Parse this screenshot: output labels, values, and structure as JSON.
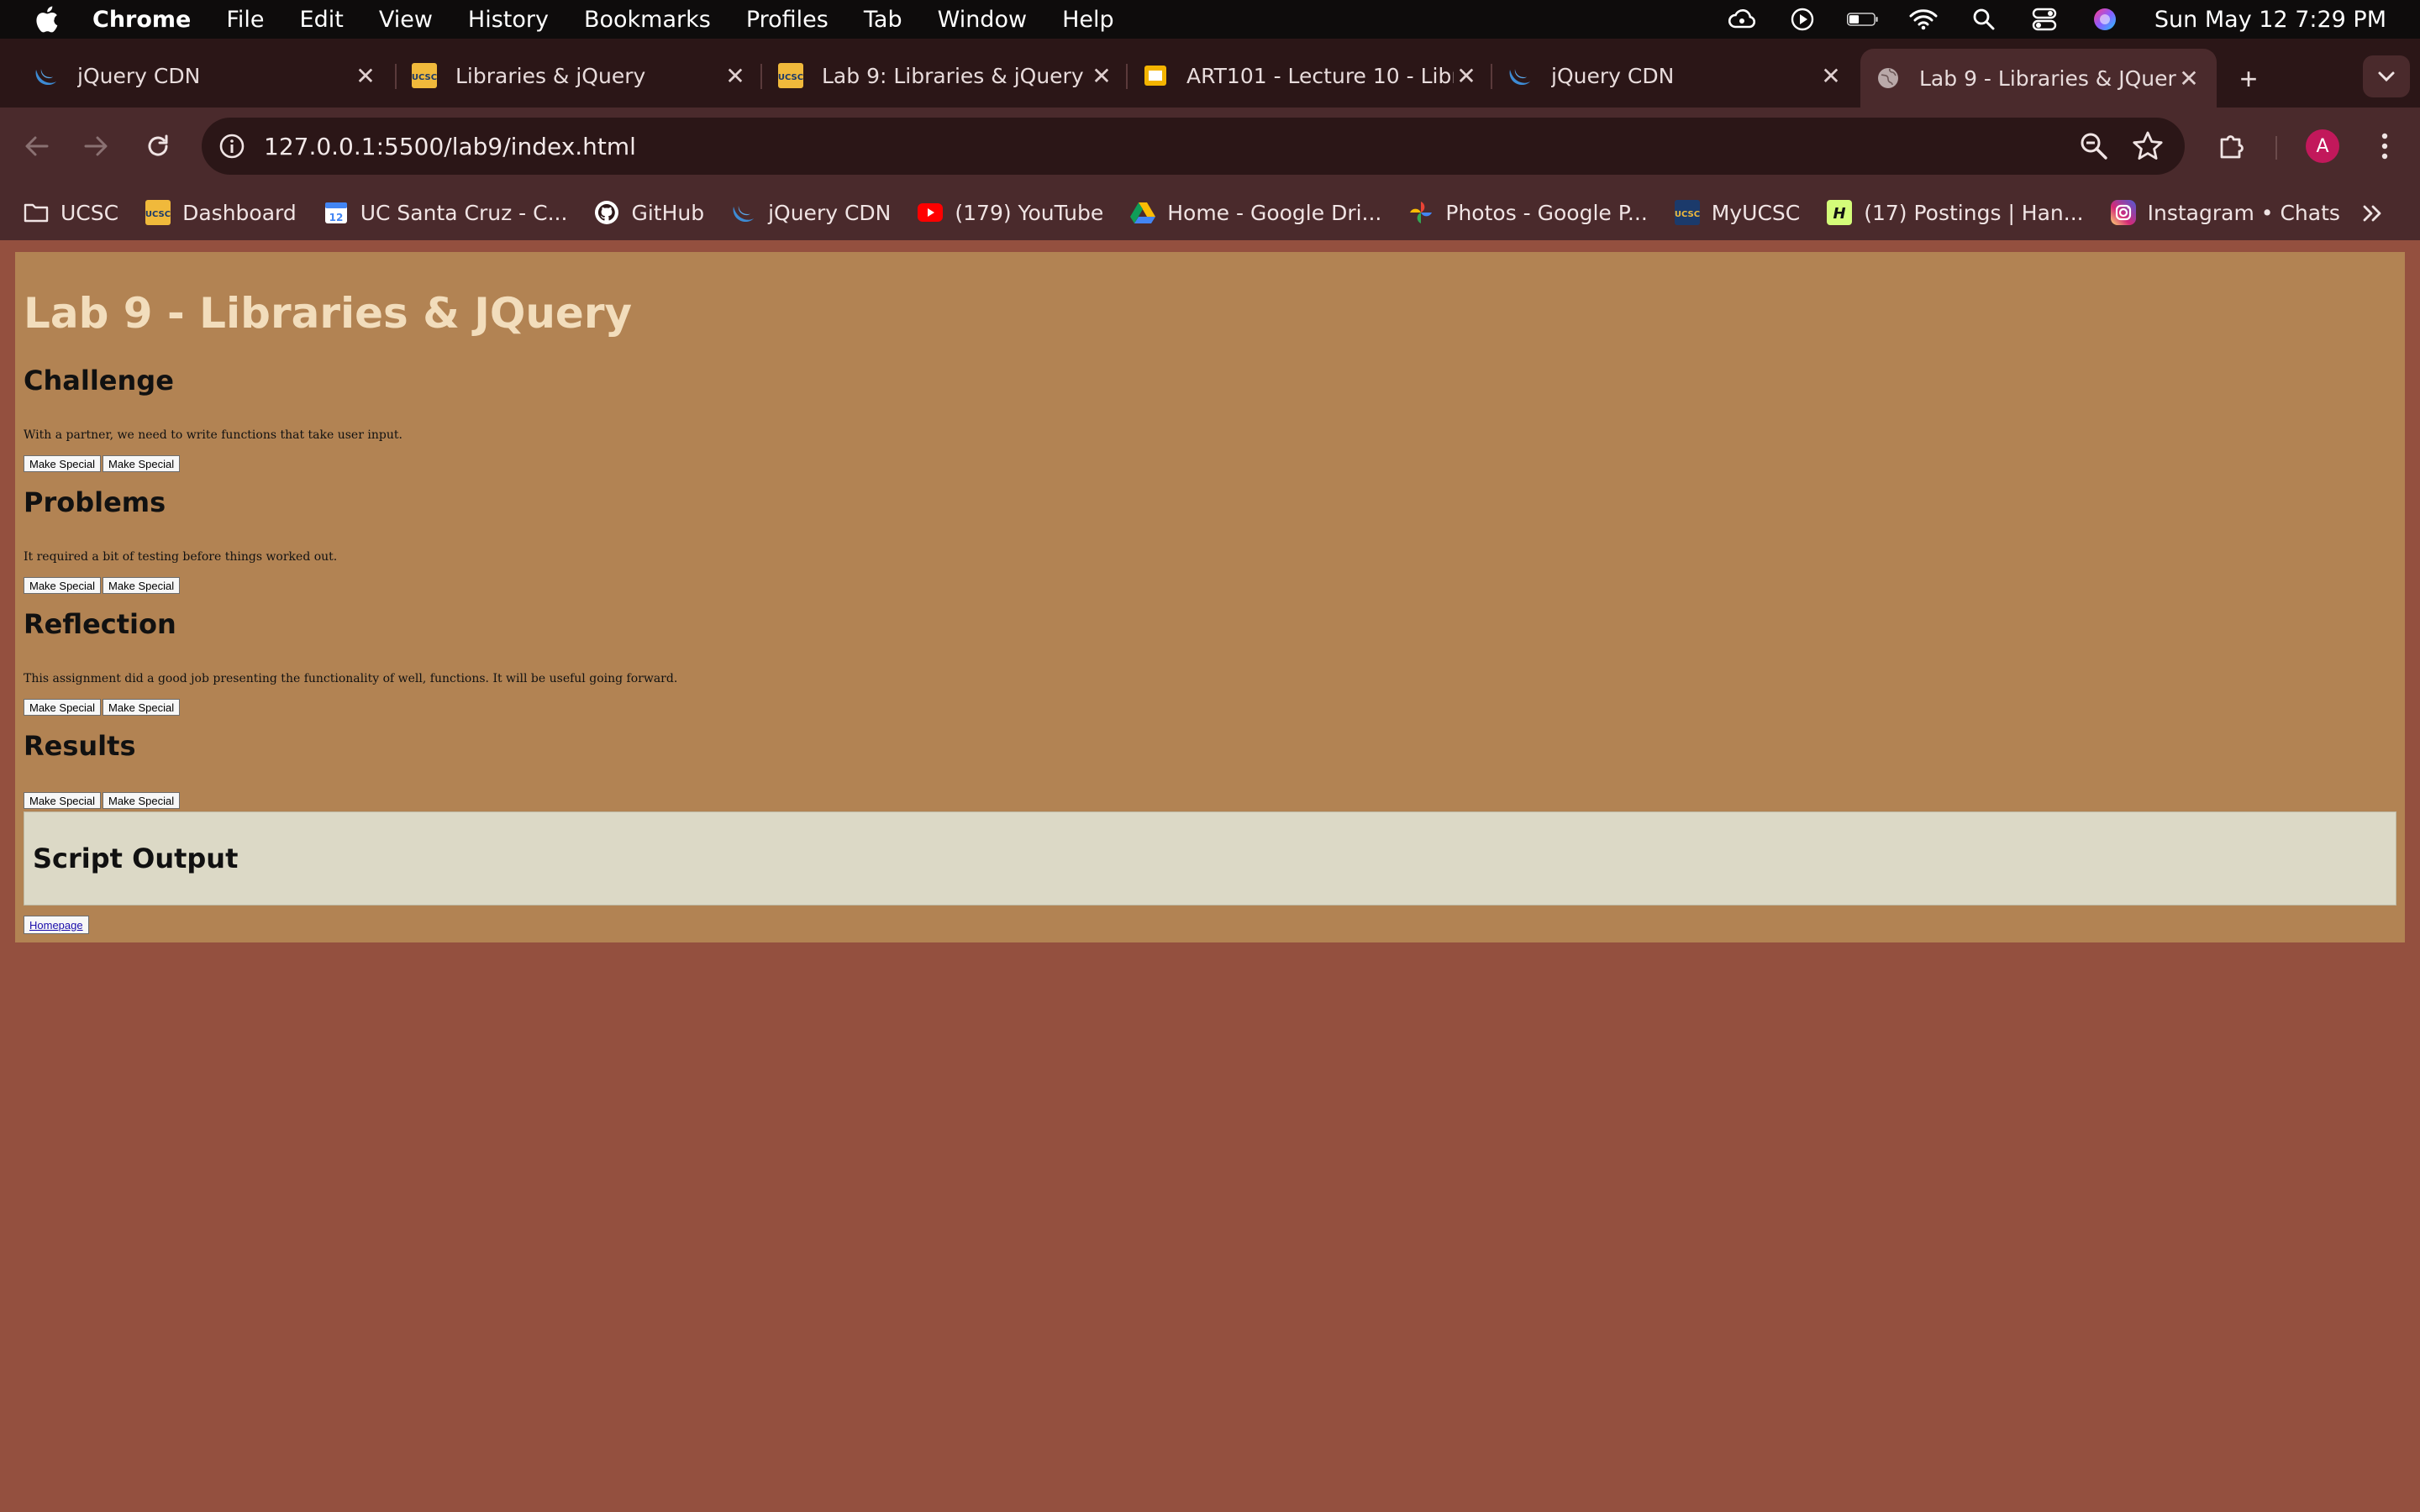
{
  "menubar": {
    "app": "Chrome",
    "items": [
      "File",
      "Edit",
      "View",
      "History",
      "Bookmarks",
      "Profiles",
      "Tab",
      "Window",
      "Help"
    ],
    "datetime": "Sun May 12  7:29 PM"
  },
  "tabs": [
    {
      "title": "jQuery CDN",
      "icon": "jquery-icon"
    },
    {
      "title": "Libraries & jQuery",
      "icon": "ucsc-icon"
    },
    {
      "title": "Lab 9: Libraries & jQuery",
      "icon": "ucsc-icon"
    },
    {
      "title": "ART101 - Lecture 10 - Libr",
      "icon": "slides-icon"
    },
    {
      "title": "jQuery CDN",
      "icon": "jquery-icon"
    },
    {
      "title": "Lab 9 - Libraries & JQuery",
      "icon": "globe-icon",
      "active": true
    }
  ],
  "toolbar": {
    "url": "127.0.0.1:5500/lab9/index.html",
    "avatar_letter": "A"
  },
  "bookmarks": [
    {
      "label": "UCSC",
      "icon": "folder-icon"
    },
    {
      "label": "Dashboard",
      "icon": "ucsc-icon"
    },
    {
      "label": "UC Santa Cruz - C...",
      "icon": "calendar-icon"
    },
    {
      "label": "GitHub",
      "icon": "github-icon"
    },
    {
      "label": "jQuery CDN",
      "icon": "jquery-icon"
    },
    {
      "label": "(179) YouTube",
      "icon": "youtube-icon"
    },
    {
      "label": "Home - Google Dri...",
      "icon": "google-drive-icon"
    },
    {
      "label": "Photos - Google P...",
      "icon": "google-photos-icon"
    },
    {
      "label": "MyUCSC",
      "icon": "ucsc-icon"
    },
    {
      "label": "(17) Postings | Han...",
      "icon": "handshake-icon"
    },
    {
      "label": "Instagram • Chats",
      "icon": "instagram-icon"
    }
  ],
  "page": {
    "title": "Lab 9 - Libraries & JQuery",
    "sections": [
      {
        "heading": "Challenge",
        "text": "With a partner, we need to write functions that take user input."
      },
      {
        "heading": "Problems",
        "text": "It required a bit of testing before things worked out."
      },
      {
        "heading": "Reflection",
        "text": "This assignment did a good job presenting the functionality of well, functions. It will be useful going forward."
      },
      {
        "heading": "Results",
        "text": ""
      }
    ],
    "button_label": "Make Special",
    "output_heading": "Script Output",
    "homepage_link": "Homepage"
  },
  "colors": {
    "page_bg": "#94503f",
    "content_bg": "#b28353",
    "title_color": "#f2ddbc",
    "output_bg": "#dcd9c6",
    "chrome_dark": "#2b1617",
    "chrome_toolbar": "#4a2a2c"
  }
}
